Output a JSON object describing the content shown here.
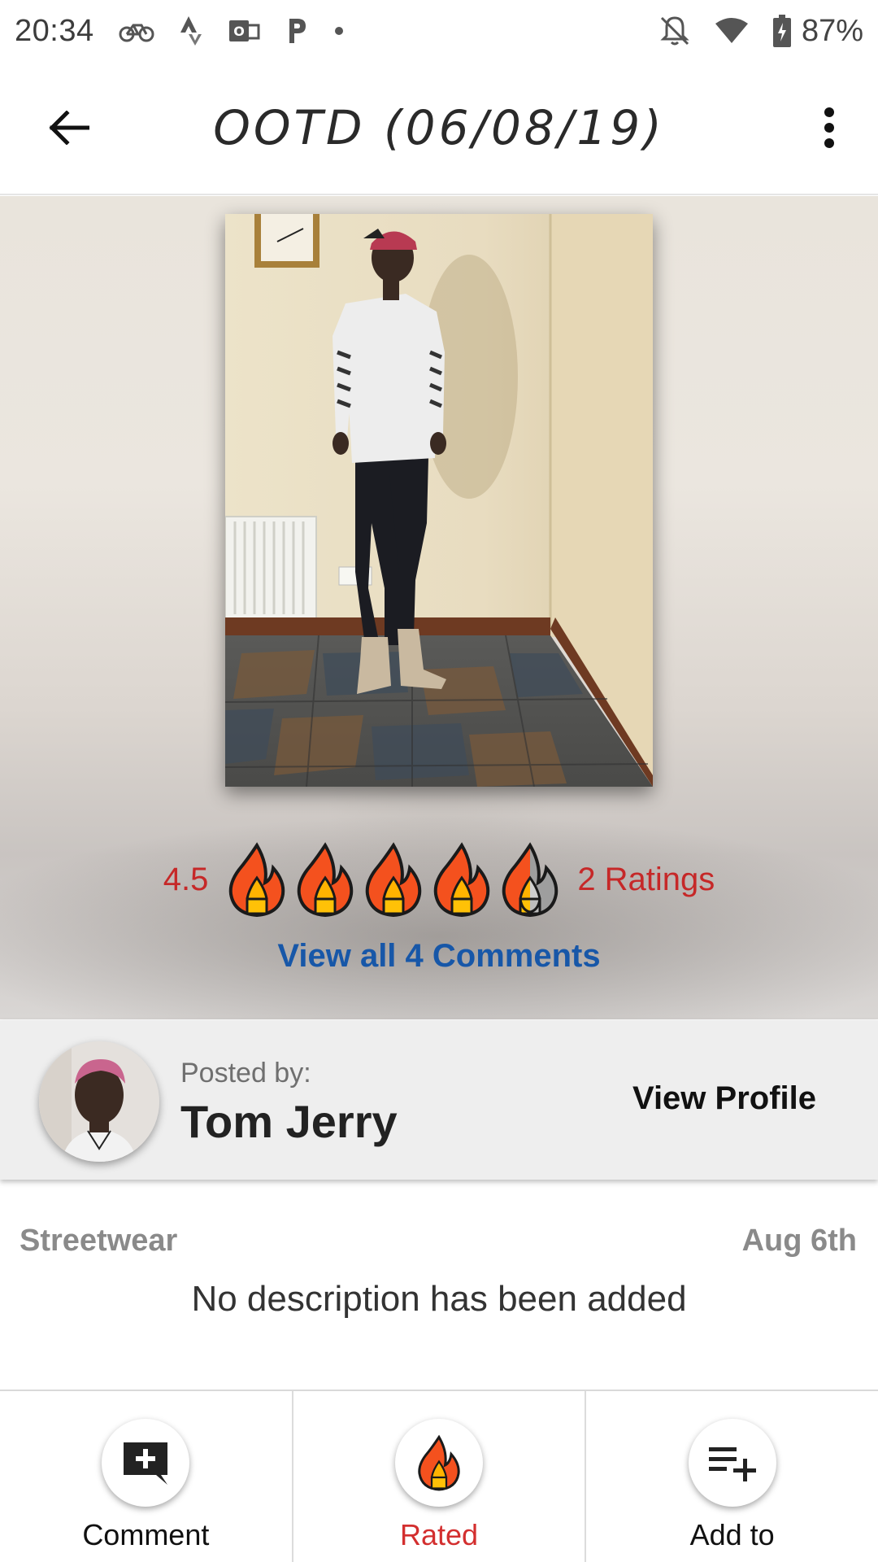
{
  "status_bar": {
    "time": "20:34",
    "battery": "87%",
    "icons": [
      "bike-icon",
      "strava-icon",
      "outlook-icon",
      "parking-icon",
      "dot-icon",
      "notifications-off-icon",
      "wifi-icon",
      "battery-charging-icon"
    ]
  },
  "app_bar": {
    "title": "OOTD (06/08/19)",
    "back_icon": "arrow-left-icon",
    "menu_icon": "more-vert-icon"
  },
  "post": {
    "rating_value": "4.5",
    "rating_level": 4.5,
    "rating_max": 5,
    "ratings_count": "2 Ratings",
    "view_comments": "View all 4 Comments"
  },
  "poster": {
    "label": "Posted by:",
    "name": "Tom Jerry",
    "view_profile": "View Profile"
  },
  "details": {
    "category": "Streetwear",
    "date": "Aug 6th",
    "description": "No description has been added"
  },
  "bottom_bar": {
    "comment_label": "Comment",
    "rated_label": "Rated",
    "add_label": "Add to"
  },
  "colors": {
    "accent_red": "#c62828",
    "link_blue": "#1757a8",
    "flame_orange": "#f4511e",
    "flame_yellow": "#ffc107"
  }
}
